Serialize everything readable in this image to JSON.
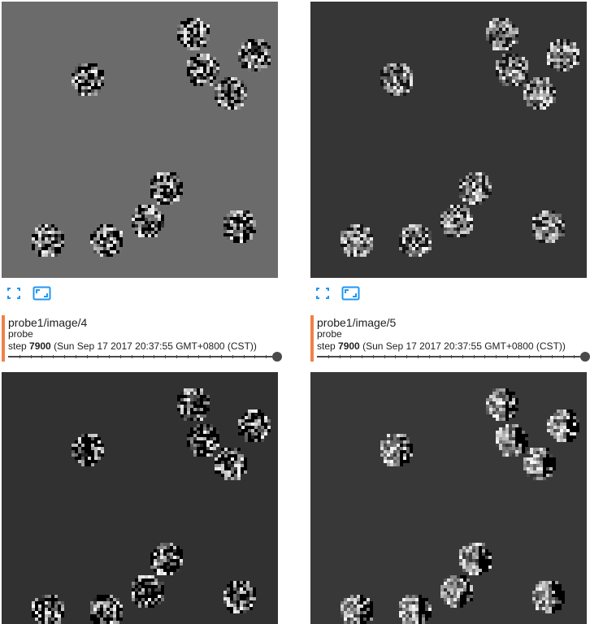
{
  "colors": {
    "accent_bar": "#f0814a",
    "icon_blue": "#2196f3",
    "bg_card_a": "#6b6b6b",
    "bg_card_b": "#353535",
    "bg_card_c": "#313131",
    "bg_card_d": "#383838"
  },
  "cards": [
    {
      "name": "probe1/image/4",
      "tag": "probe",
      "step_prefix": "step",
      "step": "7900",
      "time": "(Sun Sep 17 2017 20:37:55 GMT+0800 (CST))",
      "icons": [
        "fullscreen-icon",
        "actual-size-icon"
      ],
      "slider_value": 1.0
    },
    {
      "name": "probe1/image/5",
      "tag": "probe",
      "step_prefix": "step",
      "step": "7900",
      "time": "(Sun Sep 17 2017 20:37:55 GMT+0800 (CST))",
      "icons": [
        "fullscreen-icon",
        "actual-size-icon"
      ],
      "slider_value": 1.0
    }
  ]
}
